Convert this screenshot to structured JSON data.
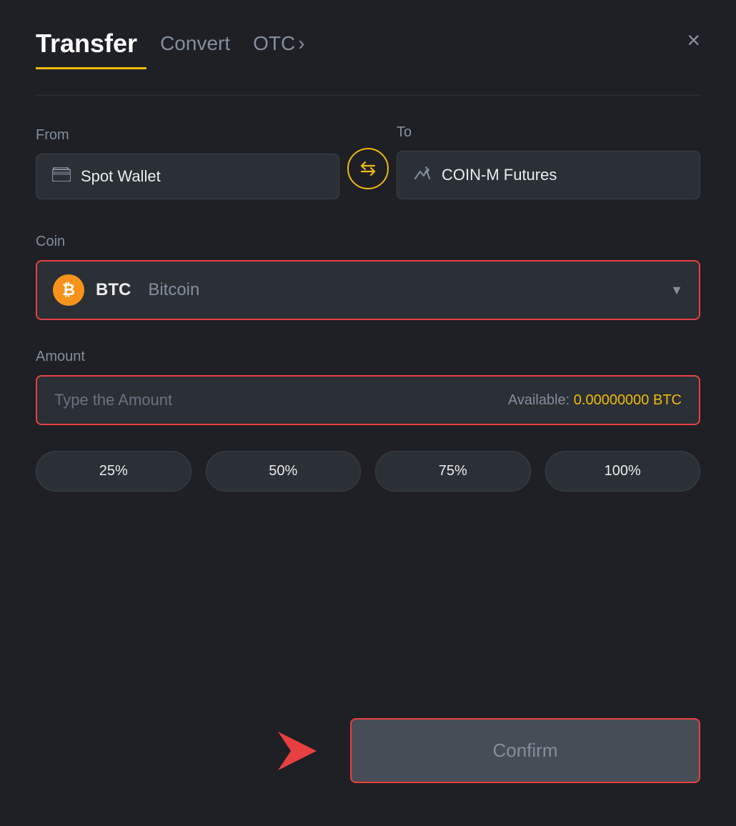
{
  "header": {
    "title": "Transfer",
    "tab_convert": "Convert",
    "tab_otc": "OTC",
    "close_label": "×"
  },
  "from": {
    "label": "From",
    "wallet_label": "Spot Wallet"
  },
  "to": {
    "label": "To",
    "wallet_label": "COIN-M Futures"
  },
  "coin": {
    "label": "Coin",
    "symbol": "BTC",
    "name": "Bitcoin"
  },
  "amount": {
    "label": "Amount",
    "placeholder": "Type the Amount",
    "available_label": "Available:",
    "available_value": "0.00000000 BTC"
  },
  "percent_buttons": [
    {
      "label": "25%"
    },
    {
      "label": "50%"
    },
    {
      "label": "75%"
    },
    {
      "label": "100%"
    }
  ],
  "confirm_button": {
    "label": "Confirm"
  }
}
